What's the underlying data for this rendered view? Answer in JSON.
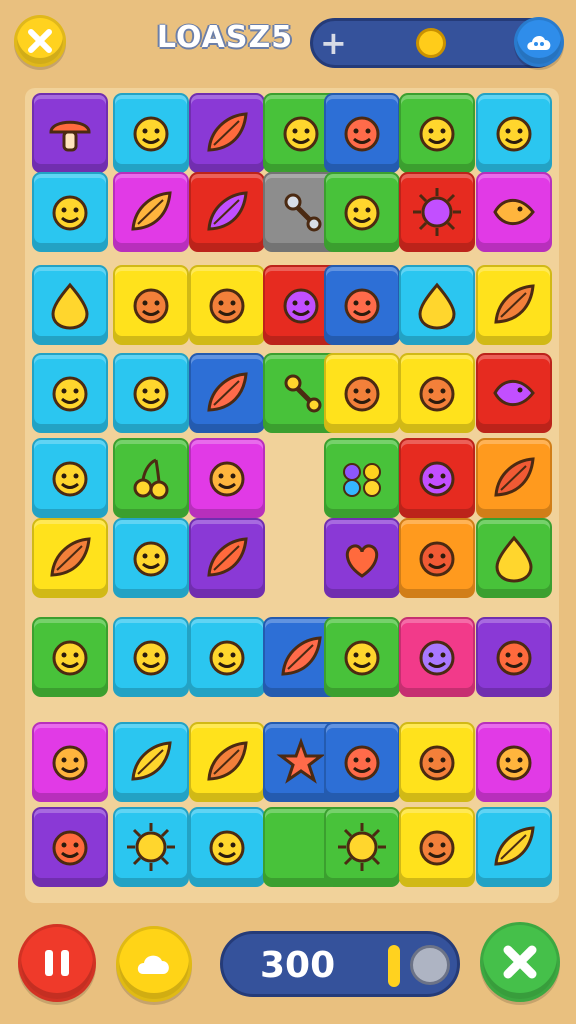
{
  "header": {
    "title": "LOASZ5",
    "close_icon": "close-icon",
    "plus_icon": "plus-icon",
    "coin_icon": "coin-icon",
    "cloud_icon": "cloud-icon"
  },
  "footer": {
    "score": "300",
    "pause_icon": "pause-icon",
    "cloud_icon": "cloud-icon",
    "dial_icon": "dial-icon",
    "shuffle_icon": "shuffle-icon"
  },
  "palette": {
    "purple": "#8a39d6",
    "cyan": "#2bc6f0",
    "green": "#48c23a",
    "blue": "#2d6fd6",
    "red": "#e62b20",
    "magenta": "#e13ae6",
    "gray": "#8d8d8d",
    "yellow": "#ffe21c",
    "orange": "#ff9a1e",
    "pink": "#f23a8a"
  },
  "tiles": [
    {
      "color": "purple",
      "icon": "mushroom"
    },
    {
      "color": "cyan",
      "icon": "face"
    },
    {
      "color": "purple",
      "icon": "leaf"
    },
    {
      "color": "green",
      "icon": "face"
    },
    {
      "color": "blue",
      "icon": "face"
    },
    {
      "color": "green",
      "icon": "face"
    },
    {
      "color": "cyan",
      "icon": "face"
    },
    {
      "color": "cyan",
      "icon": "face"
    },
    {
      "color": "magenta",
      "icon": "leaf"
    },
    {
      "color": "red",
      "icon": "leaf"
    },
    {
      "color": "gray",
      "icon": "gear"
    },
    {
      "color": "green",
      "icon": "face"
    },
    {
      "color": "red",
      "icon": "sun"
    },
    {
      "color": "magenta",
      "icon": "fish"
    },
    {
      "color": "cyan",
      "icon": "drop"
    },
    {
      "color": "yellow",
      "icon": "face"
    },
    {
      "color": "yellow",
      "icon": "face"
    },
    {
      "color": "red",
      "icon": "face"
    },
    {
      "color": "blue",
      "icon": "face"
    },
    {
      "color": "cyan",
      "icon": "drop"
    },
    {
      "color": "yellow",
      "icon": "leaf"
    },
    {
      "color": "cyan",
      "icon": "face"
    },
    {
      "color": "cyan",
      "icon": "face"
    },
    {
      "color": "blue",
      "icon": "leaf"
    },
    {
      "color": "green",
      "icon": "gear"
    },
    {
      "color": "yellow",
      "icon": "face"
    },
    {
      "color": "yellow",
      "icon": "face"
    },
    {
      "color": "red",
      "icon": "fish"
    },
    {
      "color": "cyan",
      "icon": "face"
    },
    {
      "color": "green",
      "icon": "cherry"
    },
    {
      "color": "magenta",
      "icon": "face"
    },
    {
      "color": "green",
      "icon": "balls"
    },
    {
      "color": "red",
      "icon": "face"
    },
    {
      "color": "orange",
      "icon": "leaf"
    },
    {
      "color": "yellow",
      "icon": "leaf"
    },
    {
      "color": "cyan",
      "icon": "face"
    },
    {
      "color": "purple",
      "icon": "leaf"
    },
    {
      "color": "purple",
      "icon": "heart"
    },
    {
      "color": "orange",
      "icon": "face"
    },
    {
      "color": "green",
      "icon": "drop"
    },
    {
      "color": "green",
      "icon": "face"
    },
    {
      "color": "cyan",
      "icon": "face"
    },
    {
      "color": "cyan",
      "icon": "face"
    },
    {
      "color": "blue",
      "icon": "leaf"
    },
    {
      "color": "green",
      "icon": "face"
    },
    {
      "color": "pink",
      "icon": "face"
    },
    {
      "color": "purple",
      "icon": "face"
    },
    {
      "color": "magenta",
      "icon": "face"
    },
    {
      "color": "cyan",
      "icon": "leaf"
    },
    {
      "color": "yellow",
      "icon": "leaf"
    },
    {
      "color": "blue",
      "icon": "star"
    },
    {
      "color": "blue",
      "icon": "face"
    },
    {
      "color": "yellow",
      "icon": "face"
    },
    {
      "color": "magenta",
      "icon": "face"
    },
    {
      "color": "purple",
      "icon": "face"
    },
    {
      "color": "cyan",
      "icon": "sun"
    },
    {
      "color": "cyan",
      "icon": "face"
    },
    {
      "color": "green",
      "icon": "none"
    },
    {
      "color": "green",
      "icon": "sun"
    },
    {
      "color": "yellow",
      "icon": "face"
    },
    {
      "color": "cyan",
      "icon": "leaf"
    }
  ]
}
